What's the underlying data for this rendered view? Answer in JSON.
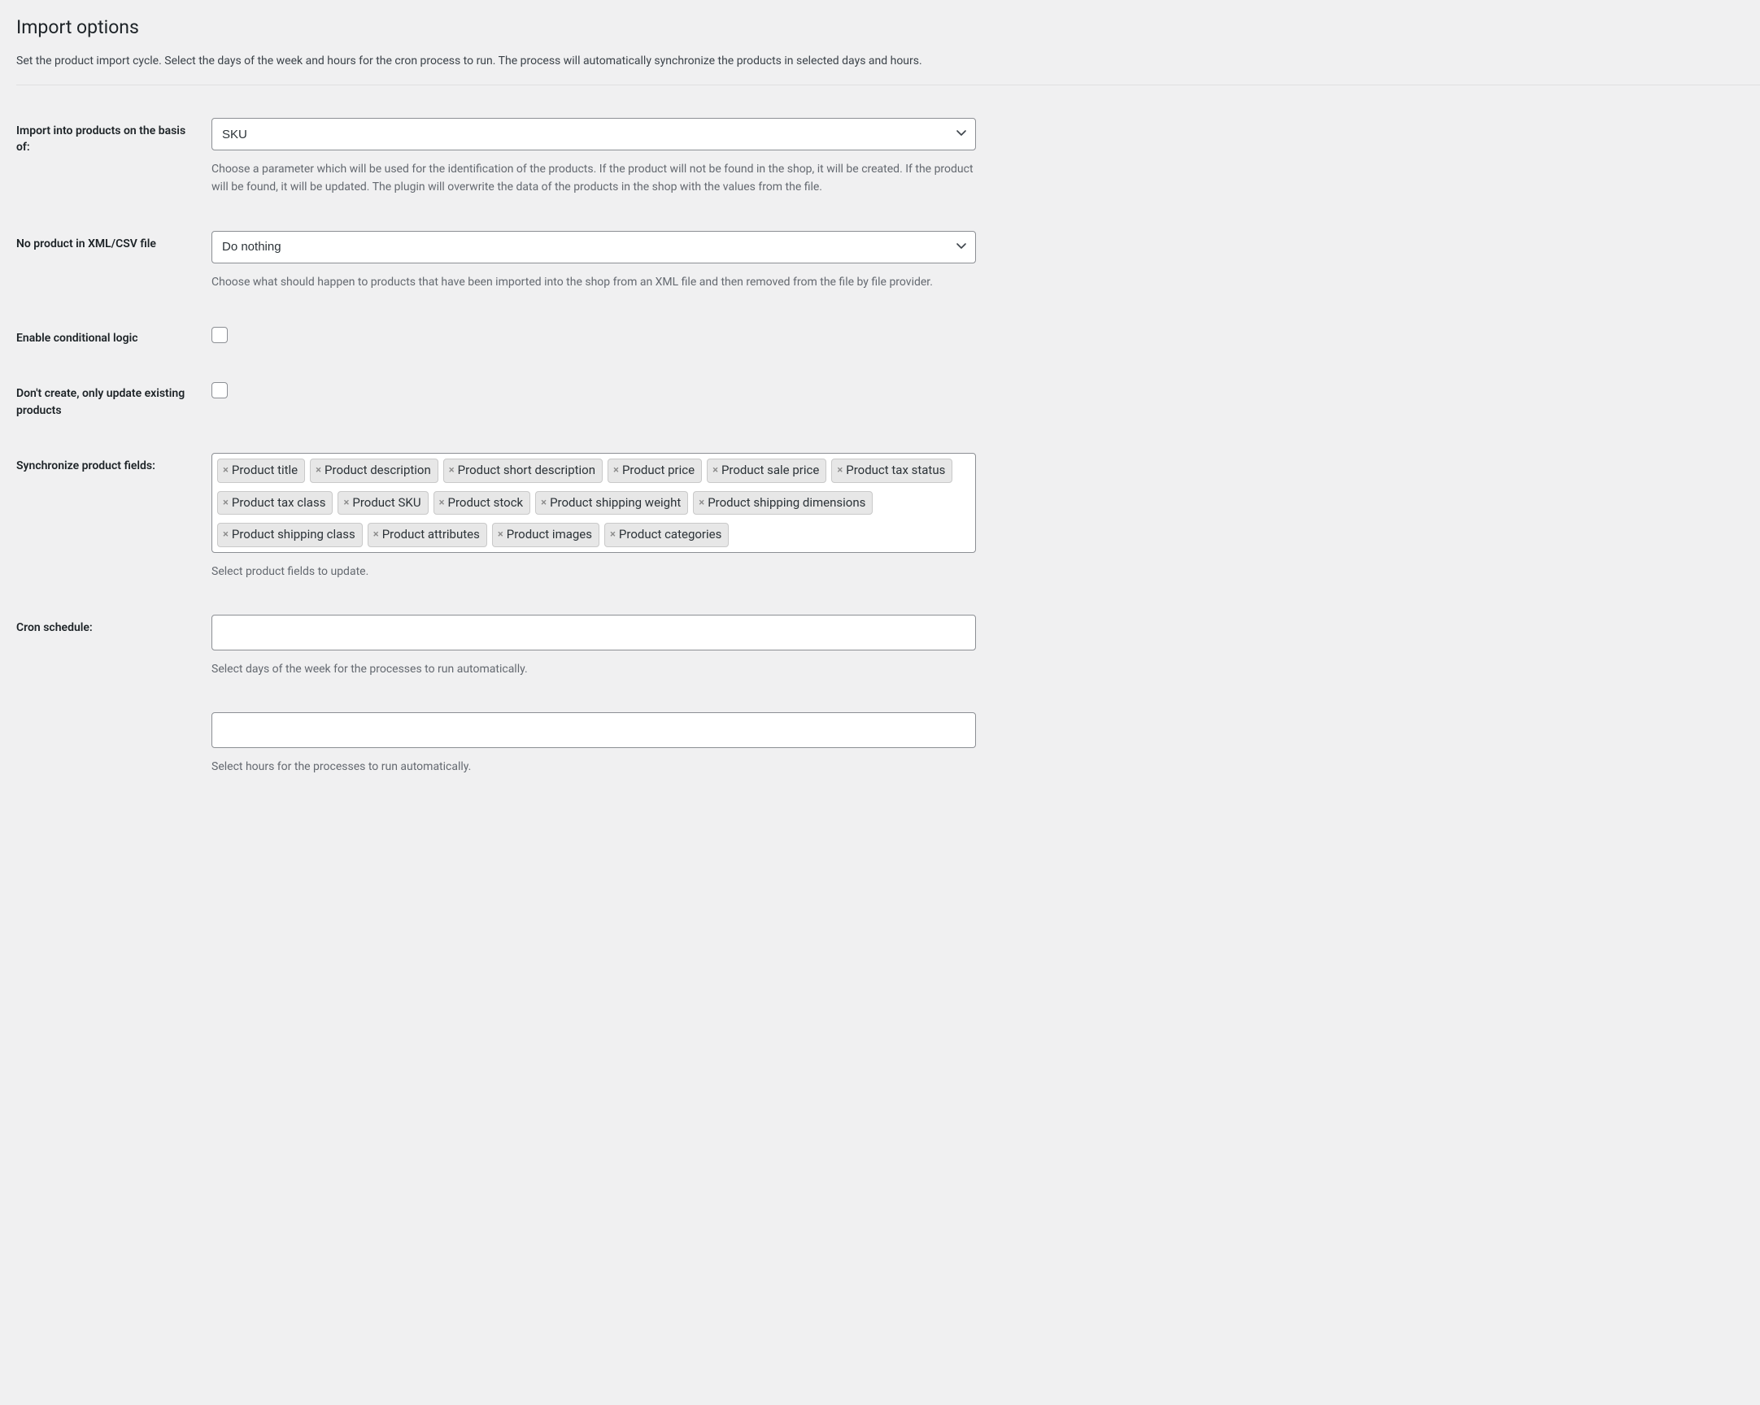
{
  "page": {
    "title": "Import options",
    "description": "Set the product import cycle. Select the days of the week and hours for the cron process to run. The process will automatically synchronize the products in selected days and hours."
  },
  "fields": {
    "import_basis": {
      "label": "Import into products on the basis of:",
      "value": "SKU",
      "help": "Choose a parameter which will be used for the identification of the products. If the product will not be found in the shop, it will be created. If the product will be found, it will be updated. The plugin will overwrite the data of the products in the shop with the values from the file."
    },
    "no_product": {
      "label": "No product in XML/CSV file",
      "value": "Do nothing",
      "help": "Choose what should happen to products that have been imported into the shop from an XML file and then removed from the file by file provider."
    },
    "conditional_logic": {
      "label": "Enable conditional logic"
    },
    "only_update": {
      "label": "Don't create, only update existing products"
    },
    "sync_fields": {
      "label": "Synchronize product fields:",
      "tags": [
        "Product title",
        "Product description",
        "Product short description",
        "Product price",
        "Product sale price",
        "Product tax status",
        "Product tax class",
        "Product SKU",
        "Product stock",
        "Product shipping weight",
        "Product shipping dimensions",
        "Product shipping class",
        "Product attributes",
        "Product images",
        "Product categories"
      ],
      "help": "Select product fields to update."
    },
    "cron_days": {
      "label": "Cron schedule:",
      "help": "Select days of the week for the processes to run automatically."
    },
    "cron_hours": {
      "help": "Select hours for the processes to run automatically."
    }
  }
}
